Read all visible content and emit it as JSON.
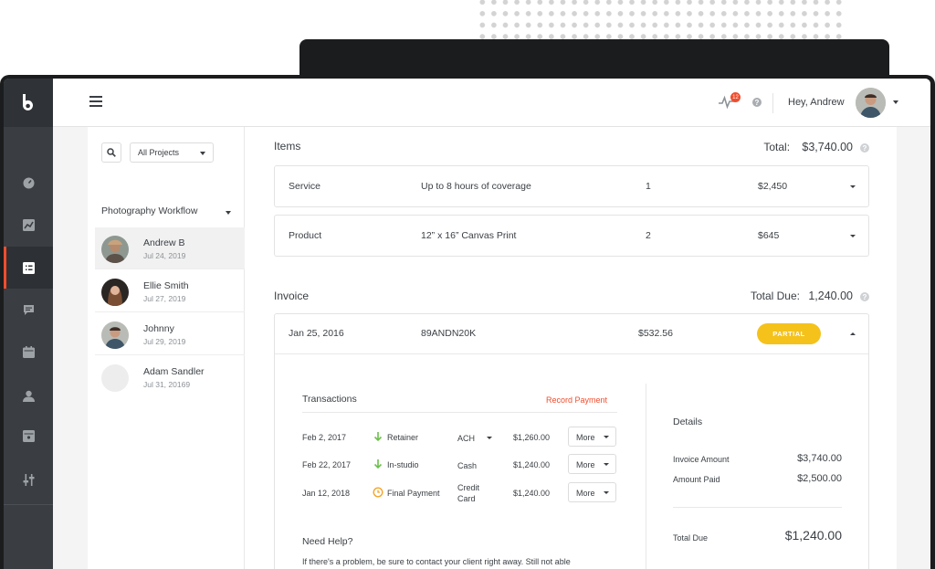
{
  "header": {
    "notifications_count": "12",
    "greeting": "Hey, Andrew"
  },
  "projects": {
    "filter_label": "All Projects",
    "workflow_title": "Photography Workflow",
    "clients": [
      {
        "name": "Andrew B",
        "date": "Jul 24, 2019",
        "selected": true
      },
      {
        "name": "Ellie Smith",
        "date": "Jul 27, 2019"
      },
      {
        "name": "Johnny",
        "date": "Jul 29, 2019"
      },
      {
        "name": "Adam Sandler",
        "date": "Jul 31, 20169"
      }
    ]
  },
  "items": {
    "title": "Items",
    "total_label": "Total:",
    "total_value": "$3,740.00",
    "rows": [
      {
        "type": "Service",
        "description": "Up to 8 hours of coverage",
        "qty": "1",
        "price": "$2,450"
      },
      {
        "type": "Product",
        "description": "12” x 16” Canvas Print",
        "qty": "2",
        "price": "$645"
      }
    ]
  },
  "invoice": {
    "title": "Invoice",
    "total_due_label": "Total Due:",
    "total_due_value": "1,240.00",
    "date": "Jan 25, 2016",
    "number": "89ANDN20K",
    "amount": "$532.56",
    "status": "PARTIAL",
    "status_color": "#f4c21b",
    "transactions": {
      "title": "Transactions",
      "record_label": "Record Payment",
      "rows": [
        {
          "date": "Feb 2, 2017",
          "icon": "arrow-down-icon",
          "type": "Retainer",
          "method": "ACH",
          "amount": "$1,260.00",
          "more": "More"
        },
        {
          "date": "Feb 22, 2017",
          "icon": "arrow-down-icon",
          "type": "In-studio",
          "method": "Cash",
          "amount": "$1,240.00",
          "more": "More"
        },
        {
          "date": "Jan 12, 2018",
          "icon": "clock-icon",
          "type": "Final Payment",
          "method": "Credit Card",
          "method_line1": "Credit",
          "method_line2": "Card",
          "amount": "$1,240.00",
          "more": "More"
        }
      ]
    },
    "help": {
      "title": "Need Help?",
      "text": "If there's a problem, be sure to contact your client right away. Still not able"
    },
    "details": {
      "title": "Details",
      "invoice_amount_label": "Invoice Amount",
      "invoice_amount_value": "$3,740.00",
      "amount_paid_label": "Amount Paid",
      "amount_paid_value": "$2,500.00",
      "total_due_label": "Total Due",
      "total_due_value": "$1,240.00"
    }
  },
  "colors": {
    "accent": "#f04d2e",
    "sidebar": "#3a3e43",
    "positive": "#6cc04a",
    "pending": "#f4a42b"
  }
}
